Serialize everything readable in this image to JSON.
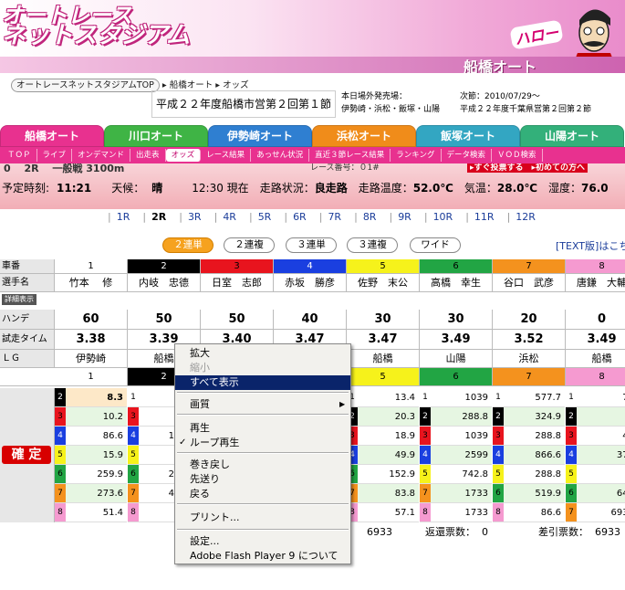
{
  "banner": {
    "logo_line1": "オートレース",
    "logo_line2": "ネットスタジアム",
    "greeting": "ハロー",
    "venue": "船橋オート"
  },
  "breadcrumb": {
    "home": "オートレースネットスタジアムTOP",
    "sep": "▸",
    "venue": "船橋オート",
    "page": "オッズ"
  },
  "meet_title": "平成２２年度船橋市営第２回第１節",
  "info": {
    "label": "本日場外発売場：",
    "value": "伊勢崎・浜松・飯塚・山陽",
    "next_label": "次節：2010/07/29〜",
    "next_value": "平成２２年度千葉県営第２回第２節"
  },
  "venue_tabs": [
    {
      "label": "船橋オート",
      "color": "#e8318f"
    },
    {
      "label": "川口オート",
      "color": "#3fb445"
    },
    {
      "label": "伊勢崎オート",
      "color": "#2f7fd1"
    },
    {
      "label": "浜松オート",
      "color": "#f08c1a"
    },
    {
      "label": "飯塚オート",
      "color": "#33a6c2"
    },
    {
      "label": "山陽オート",
      "color": "#33b07a"
    }
  ],
  "subnav": [
    "ＴＯＰ",
    "ライブ",
    "オンデマンド",
    "出走表",
    "オッズ",
    "レース結果",
    "あっせん状況",
    "直近３節レース結果",
    "ランキング",
    "データ検索",
    "ＶＯＤ検索"
  ],
  "subnav_active": 4,
  "status": {
    "top": "0　 2R　 一般戦 3100m",
    "top_mid": "レース番号：０1#",
    "top_right": "▸すぐ投票する　▸初めての方へ",
    "scheduled_label": "予定時刻:",
    "scheduled": "11:21",
    "weather_label": "天候：",
    "weather": "晴",
    "now_time": "12:30 現在",
    "track_label": "走路状況：",
    "track": "良走路",
    "track_temp_label": "走路温度：",
    "track_temp": "52.0℃",
    "air_temp_label": "気温：",
    "air_temp": "28.0℃",
    "humidity_label": "湿度：",
    "humidity": "76.0"
  },
  "races": [
    "1R",
    "2R",
    "3R",
    "4R",
    "5R",
    "6R",
    "7R",
    "8R",
    "9R",
    "10R",
    "11R",
    "12R"
  ],
  "race_active": 1,
  "bet_types": [
    "２連単",
    "２連複",
    "３連単",
    "３連複",
    "ワイド"
  ],
  "bet_active": 0,
  "text_version": "[TEXT版]はこち",
  "row_labels": {
    "car": "車番",
    "name": "選手名",
    "detail": "詳細表示",
    "handicap": "ハンデ",
    "trial": "試走タイム",
    "lg": "ＬＧ",
    "odds_label": "連単オッズ",
    "kakutei": "確 定"
  },
  "riders": [
    {
      "no": "1",
      "name": "竹本　 修",
      "color": "#ffffff",
      "fg": "#000000",
      "handicap": "60",
      "trial": "3.38",
      "lg": "伊勢崎"
    },
    {
      "no": "2",
      "name": "内岐　忠德",
      "color": "#000000",
      "fg": "#ffffff",
      "handicap": "50",
      "trial": "3.39",
      "lg": "船橋"
    },
    {
      "no": "3",
      "name": "日室　志郎",
      "color": "#e8141e",
      "fg": "#000000",
      "handicap": "50",
      "trial": "3.40",
      "lg": ""
    },
    {
      "no": "4",
      "name": "赤坂　勝彦",
      "color": "#1a3fe0",
      "fg": "#ffffff",
      "handicap": "40",
      "trial": "3.47",
      "lg": ""
    },
    {
      "no": "5",
      "name": "佐野　末公",
      "color": "#f6f21b",
      "fg": "#000000",
      "handicap": "30",
      "trial": "3.47",
      "lg": "船橋"
    },
    {
      "no": "6",
      "name": "高橋　幸生",
      "color": "#22a544",
      "fg": "#000000",
      "handicap": "30",
      "trial": "3.49",
      "lg": "山陽"
    },
    {
      "no": "7",
      "name": "谷口　武彦",
      "color": "#f4921e",
      "fg": "#000000",
      "handicap": "20",
      "trial": "3.52",
      "lg": "浜松"
    },
    {
      "no": "8",
      "name": "唐鎌　大輔",
      "color": "#f59ad0",
      "fg": "#000000",
      "handicap": "0",
      "trial": "3.49",
      "lg": "船橋"
    }
  ],
  "odds": {
    "col1": [
      [
        "2",
        "8.3"
      ],
      [
        "3",
        "10.2"
      ],
      [
        "4",
        "86.6"
      ],
      [
        "5",
        "15.9"
      ],
      [
        "6",
        "259.9"
      ],
      [
        "7",
        "273.6"
      ],
      [
        "8",
        "51.4"
      ]
    ],
    "col2_keys": [
      "1",
      "3",
      "4",
      "5",
      "6",
      "7",
      "8"
    ],
    "col2_vals": [
      "",
      "",
      "1",
      "",
      "2",
      "4",
      ""
    ],
    "col5": [
      [
        "1",
        "13.4"
      ],
      [
        "2",
        "20.3"
      ],
      [
        "3",
        "18.9"
      ],
      [
        "4",
        "49.9"
      ],
      [
        "6",
        "152.9"
      ],
      [
        "7",
        "83.8"
      ],
      [
        "8",
        "57.1"
      ]
    ],
    "col6": [
      [
        "1",
        "1039"
      ],
      [
        "2",
        "288.8"
      ],
      [
        "3",
        "1039"
      ],
      [
        "4",
        "2599"
      ],
      [
        "5",
        "742.8"
      ],
      [
        "7",
        "1733"
      ],
      [
        "8",
        "1733"
      ]
    ],
    "col7": [
      [
        "1",
        "577.7"
      ],
      [
        "2",
        "324.9"
      ],
      [
        "3",
        "288.8"
      ],
      [
        "4",
        "866.6"
      ],
      [
        "5",
        "288.8"
      ],
      [
        "6",
        "519.9"
      ],
      [
        "8",
        "86.6"
      ]
    ],
    "col8": [
      [
        "1",
        "76"
      ],
      [
        "2",
        "8"
      ],
      [
        "3",
        "43"
      ],
      [
        "4",
        "371"
      ],
      [
        "5",
        "7"
      ],
      [
        "6",
        "649"
      ],
      [
        "7",
        "6933"
      ]
    ]
  },
  "footer": {
    "sold": "6933",
    "refund_label": "返還票数：",
    "refund": "0",
    "diff_label": "差引票数：",
    "diff": "6933"
  },
  "context_menu": [
    {
      "label": "拡大",
      "enabled": true
    },
    {
      "label": "縮小",
      "enabled": false
    },
    {
      "label": "すべて表示",
      "highlighted": true
    },
    {
      "label": "画質",
      "submenu": true
    },
    {
      "label": "再生"
    },
    {
      "label": "ループ再生",
      "checked": true
    },
    {
      "label": "巻き戻し"
    },
    {
      "label": "先送り"
    },
    {
      "label": "戻る"
    },
    {
      "label": "プリント..."
    },
    {
      "label": "設定..."
    },
    {
      "label": "Adobe Flash Player 9 について"
    }
  ]
}
